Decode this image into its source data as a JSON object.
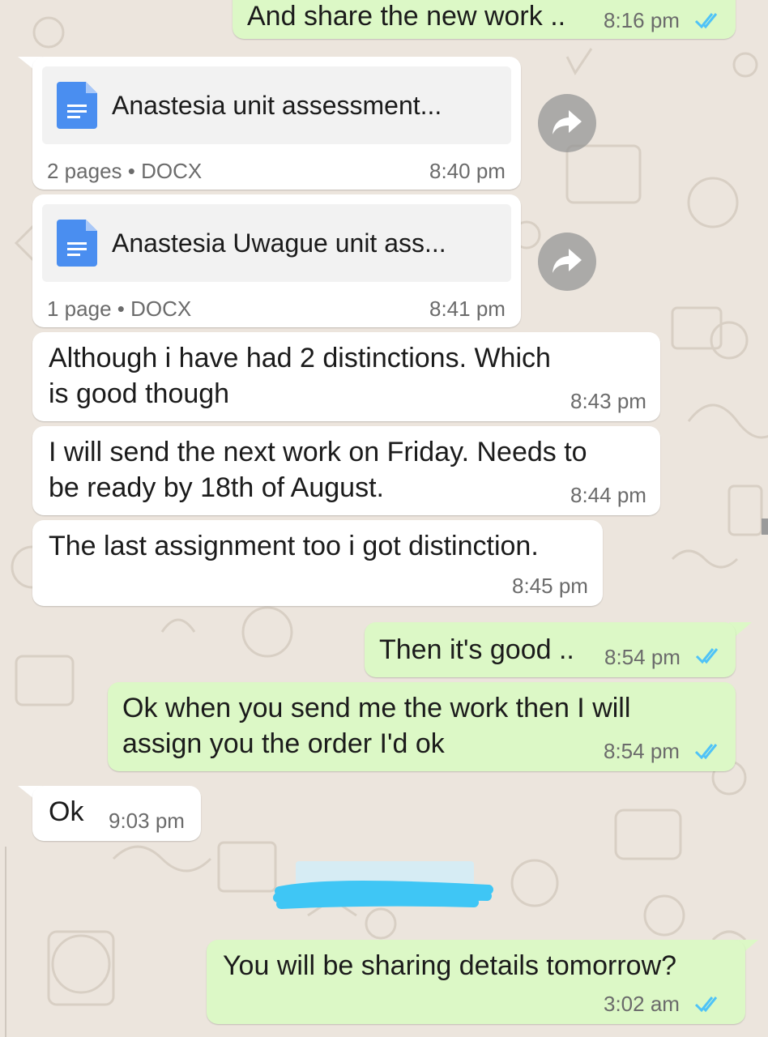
{
  "chat": {
    "messages": [
      {
        "text": "And share the new work ..",
        "time": "8:16 pm"
      },
      {
        "doc_name": "Anastesia unit assessment...",
        "meta": "2 pages • DOCX",
        "time": "8:40 pm"
      },
      {
        "doc_name": "Anastesia Uwague unit ass...",
        "meta": "1 page • DOCX",
        "time": "8:41 pm"
      },
      {
        "line1": "Although i have had 2 distinctions. Which",
        "line2": "is good though",
        "time": "8:43 pm"
      },
      {
        "line1": "I will send the next work on Friday. Needs to",
        "line2": "be ready by 18th of August.",
        "time": "8:44 pm"
      },
      {
        "text": "The last assignment too i got distinction.",
        "time": "8:45 pm"
      },
      {
        "text": "Then it's good ..",
        "time": "8:54 pm"
      },
      {
        "line1": "Ok when you send me the work then I will",
        "line2": "assign you the order I'd ok",
        "time": "8:54 pm"
      },
      {
        "text": "Ok",
        "time": "9:03 pm"
      },
      {
        "text": "You will be sharing details tomorrow?",
        "time": "3:02 am"
      }
    ]
  },
  "colors": {
    "outgoing_bubble": "#dcf8c6",
    "incoming_bubble": "#ffffff",
    "read_ticks": "#4fc3f7",
    "doc_icon": "#4a8ef0",
    "scribble": "#3fc6f5"
  },
  "icons": {
    "document": "doc-icon",
    "forward": "forward-icon",
    "read_receipt": "double-check-icon"
  }
}
